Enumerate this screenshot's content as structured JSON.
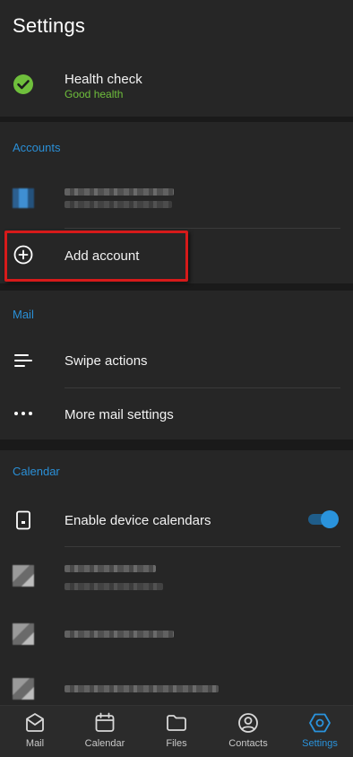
{
  "header": {
    "title": "Settings"
  },
  "health": {
    "title": "Health check",
    "status": "Good health",
    "status_color": "#6fbf3c"
  },
  "accounts": {
    "section_label": "Accounts",
    "add_account_label": "Add account"
  },
  "mail": {
    "section_label": "Mail",
    "swipe_actions_label": "Swipe actions",
    "more_settings_label": "More mail settings"
  },
  "calendar": {
    "section_label": "Calendar",
    "enable_device_label": "Enable device calendars",
    "enable_device_on": true
  },
  "bottom_nav": {
    "items": [
      {
        "label": "Mail",
        "icon": "mail-icon",
        "active": false
      },
      {
        "label": "Calendar",
        "icon": "calendar-icon",
        "active": false
      },
      {
        "label": "Files",
        "icon": "folder-icon",
        "active": false
      },
      {
        "label": "Contacts",
        "icon": "contact-icon",
        "active": false
      },
      {
        "label": "Settings",
        "icon": "settings-icon",
        "active": true
      }
    ]
  },
  "colors": {
    "accent": "#2a93dc",
    "highlight_border": "#d61a1a",
    "background": "#1a1a1a",
    "card": "#262626"
  }
}
